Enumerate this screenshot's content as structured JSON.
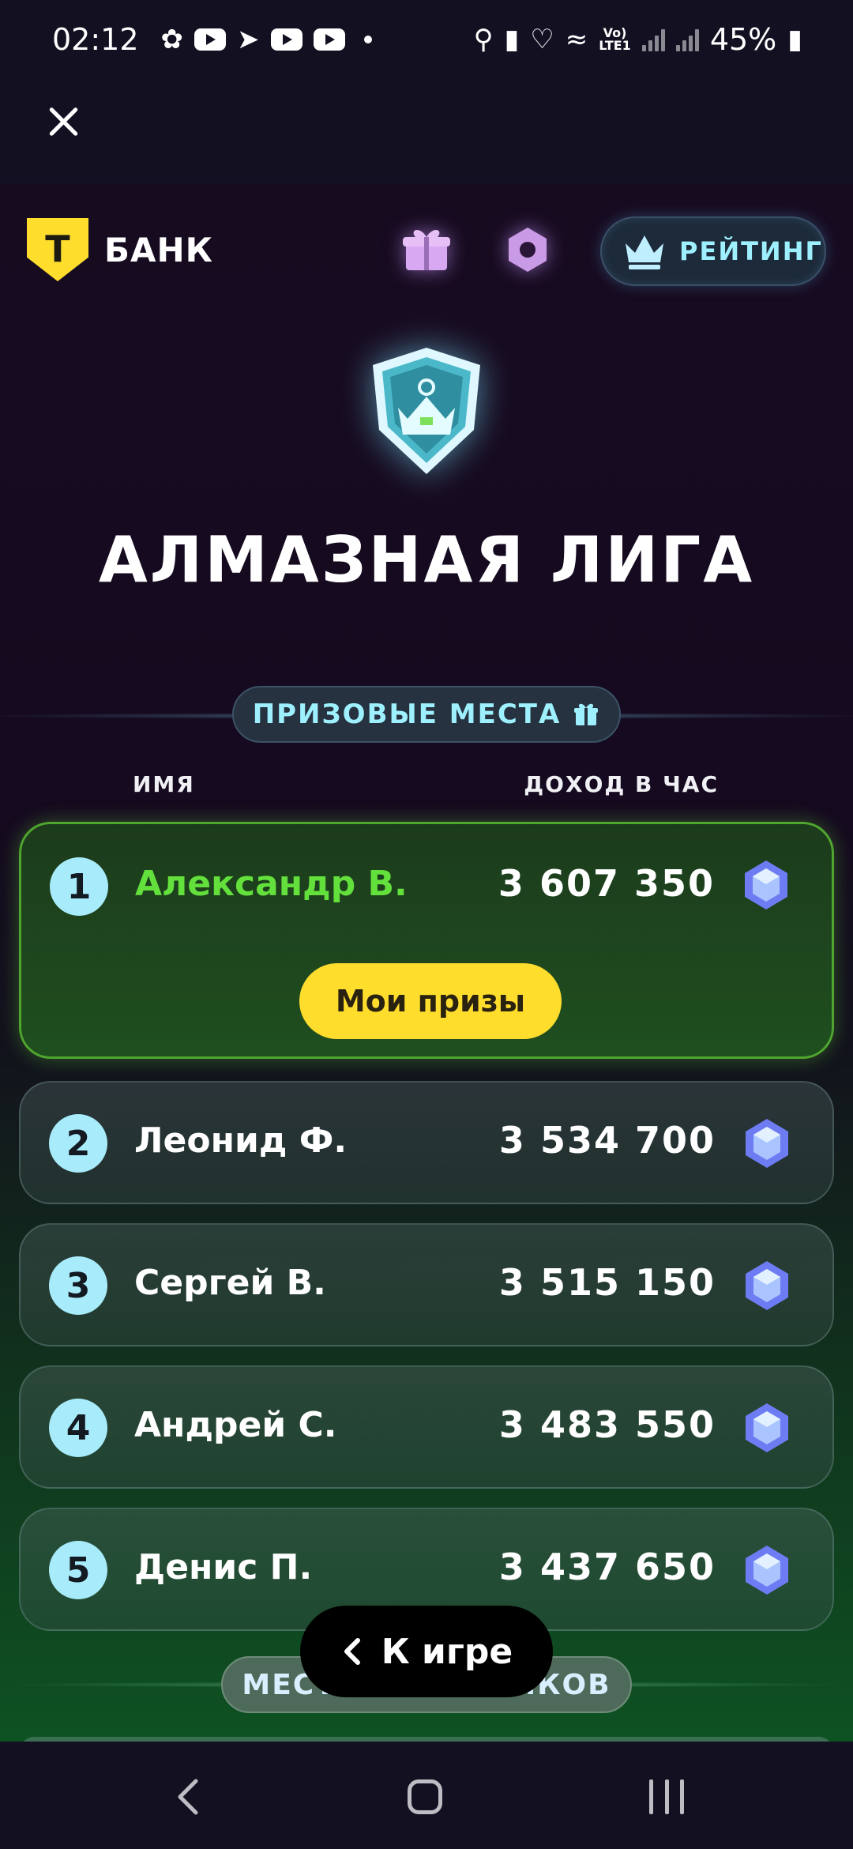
{
  "status_bar": {
    "time": "02:12",
    "battery": "45%",
    "network_label_top": "Vo)",
    "network_label_bottom": "LTE1"
  },
  "close_button": {
    "icon": "close-icon"
  },
  "header": {
    "brand_letter": "Т",
    "brand_name": "БАНК",
    "gift_icon": "gift-icon",
    "settings_icon": "settings-icon",
    "rating_label": "РЕЙТИНГ"
  },
  "league": {
    "title": "АЛМАЗНАЯ ЛИГА"
  },
  "prizes_section": {
    "label": "ПРИЗОВЫЕ МЕСТА",
    "col_name": "ИМЯ",
    "col_income": "ДОХОД В ЧАС"
  },
  "leaderboard": [
    {
      "rank": "1",
      "name": "Александр В.",
      "value": "3 607 350",
      "is_me": true
    },
    {
      "rank": "2",
      "name": "Леонид Ф.",
      "value": "3 534 700"
    },
    {
      "rank": "3",
      "name": "Сергей В.",
      "value": "3 515 150"
    },
    {
      "rank": "4",
      "name": "Андрей С.",
      "value": "3 483 550"
    },
    {
      "rank": "5",
      "name": "Денис П.",
      "value": "3 437 650"
    }
  ],
  "my_prizes_button": "Мои призы",
  "participants_label": "МЕСТА УЧАСТНИКОВ",
  "back_to_game_button": "К игре",
  "colors": {
    "accent_yellow": "#ffdd2d",
    "highlight_green": "#63e03c",
    "rank_badge": "#a8ecfb",
    "pill_text": "#9ef0ff"
  }
}
